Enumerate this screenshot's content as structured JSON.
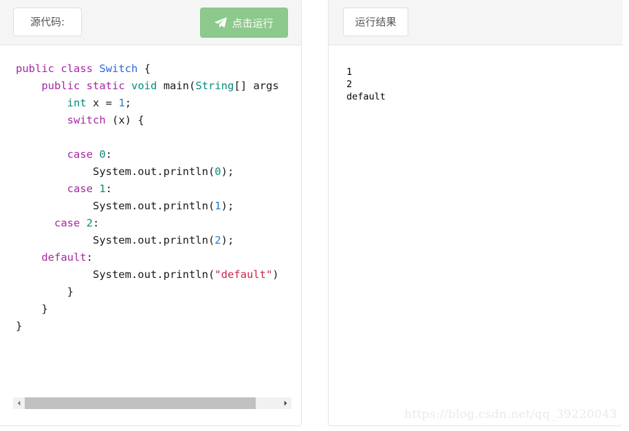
{
  "source_panel": {
    "tag_label": "源代码:",
    "run_button_label": "点击运行",
    "run_button_icon": "send-paper-plane-icon",
    "run_button_color": "#8dc98d",
    "code_lines": [
      "public class Switch {",
      "    public static void main(String[] args",
      "        int x = 1;",
      "        switch (x) {",
      "",
      "        case 0:",
      "            System.out.println(0);",
      "        case 1:",
      "            System.out.println(1);",
      "      case 2:",
      "            System.out.println(2);",
      "    default:",
      "            System.out.println(\"default\")",
      "        }",
      "    }",
      "}"
    ],
    "scrollbar": {
      "left_arrow_icon": "triangle-left-icon",
      "right_arrow_icon": "triangle-right-icon",
      "thumb_position_percent": 0,
      "thumb_width_percent": 90
    }
  },
  "result_panel": {
    "tag_label": "运行结果",
    "output": "1\n2\ndefault"
  },
  "watermark": {
    "text": "https://blog.csdn.net/qq_39220043"
  },
  "syntax_colors": {
    "keyword": "#a626a4",
    "class_name": "#2b65d9",
    "type": "#068a7a",
    "number": "#1f7ac8",
    "string": "#c7254e",
    "plain": "#1a1a1a"
  }
}
